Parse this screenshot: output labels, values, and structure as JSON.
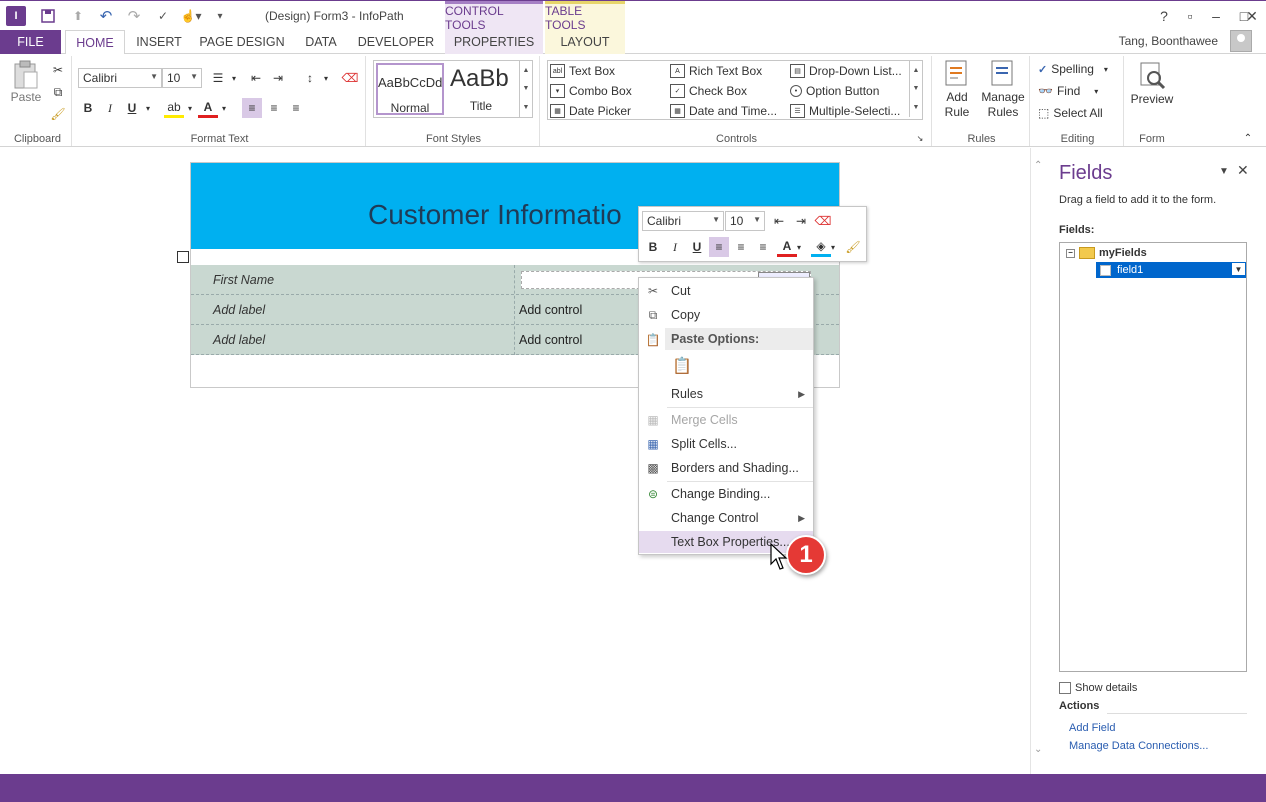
{
  "window": {
    "title": "(Design) Form3 - InfoPath",
    "app_icon_letter": "I",
    "context_groups": {
      "control_tools": "CONTROL TOOLS",
      "table_tools": "TABLE TOOLS"
    },
    "help": "?",
    "user_name": "Tang, Boonthawee"
  },
  "tabs": [
    "FILE",
    "HOME",
    "INSERT",
    "PAGE DESIGN",
    "DATA",
    "DEVELOPER",
    "PROPERTIES",
    "LAYOUT"
  ],
  "ribbon": {
    "clipboard": {
      "paste_label": "Paste",
      "group_label": "Clipboard"
    },
    "format_text": {
      "font": "Calibri",
      "size": "10",
      "bold": "B",
      "italic": "I",
      "underline": "U",
      "group_label": "Format Text"
    },
    "font_styles": {
      "normal_sample": "AaBbCcDd",
      "normal_label": "Normal",
      "title_sample": "AaBb",
      "title_label": "Title",
      "group_label": "Font Styles"
    },
    "controls": {
      "items": [
        "Text Box",
        "Combo Box",
        "Date Picker",
        "Rich Text Box",
        "Check Box",
        "Date and Time...",
        "Drop-Down List...",
        "Option Button",
        "Multiple-Selecti..."
      ],
      "group_label": "Controls"
    },
    "rules": {
      "add_rule": "Add Rule",
      "manage_rules": "Manage Rules",
      "group_label": "Rules"
    },
    "editing": {
      "spelling": "Spelling",
      "find": "Find",
      "select_all": "Select All",
      "group_label": "Editing"
    },
    "form": {
      "preview": "Preview",
      "group_label": "Form"
    }
  },
  "form": {
    "title": "Customer Informatio",
    "rows": [
      {
        "label": "First Name",
        "control": ""
      },
      {
        "label": "Add label",
        "control": "Add control"
      },
      {
        "label": "Add label",
        "control": "Add control"
      }
    ],
    "field_tag": "field1"
  },
  "mini_toolbar": {
    "font": "Calibri",
    "size": "10",
    "bold": "B",
    "italic": "I",
    "underline": "U"
  },
  "context_menu": {
    "cut": "Cut",
    "copy": "Copy",
    "paste_options": "Paste Options:",
    "rules": "Rules",
    "merge_cells": "Merge Cells",
    "split_cells": "Split Cells...",
    "borders_shading": "Borders and Shading...",
    "change_binding": "Change Binding...",
    "change_control": "Change Control",
    "textbox_properties": "Text Box Properties..."
  },
  "callout_number": "1",
  "fields_pane": {
    "title": "Fields",
    "description": "Drag a field to add it to the form.",
    "fields_label": "Fields:",
    "root": "myFields",
    "child": "field1",
    "show_details": "Show details",
    "actions_label": "Actions",
    "add_field": "Add Field",
    "manage_connections": "Manage Data Connections..."
  },
  "colors": {
    "accent": "#6b3c8e",
    "header_band": "#00b0f0",
    "table_bg": "#c9d8d1",
    "callout": "#e53935"
  }
}
